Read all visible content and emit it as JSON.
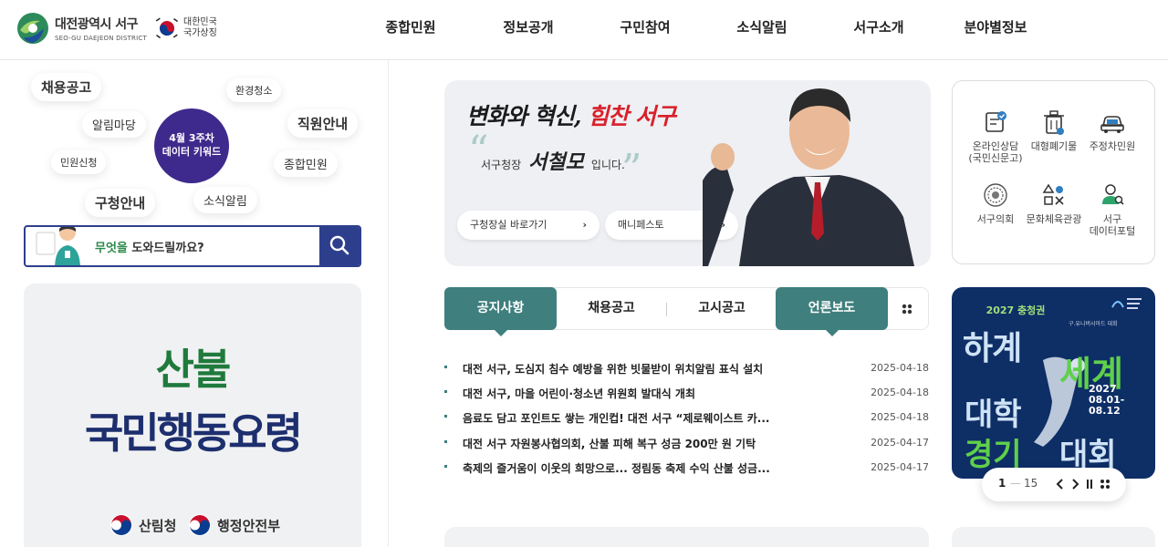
{
  "header": {
    "logo_ko": "대전광역시 서구",
    "logo_en": "SEO-GU DAEJEON DISTRICT",
    "national_symbol_line1": "대한민국",
    "national_symbol_line2": "국가상징",
    "nav": [
      "종합민원",
      "정보공개",
      "구민참여",
      "소식알림",
      "서구소개",
      "분야별정보"
    ]
  },
  "keywords": {
    "center_line1": "4월 3주차",
    "center_line2": "데이터 키워드",
    "items": [
      "채용공고",
      "환경청소",
      "알림마당",
      "직원안내",
      "민원신청",
      "종합민원",
      "구청안내",
      "소식알림"
    ]
  },
  "search": {
    "prompt_highlight": "무엇을",
    "prompt_rest": " 도와드릴까요?"
  },
  "left_banner": {
    "line1": "산불",
    "line2": "국민행동요령",
    "agency1": "산림청",
    "agency2": "행정안전부"
  },
  "mayor_banner": {
    "slogan_part1": "변화와 혁신, ",
    "slogan_part2": "힘찬 서구",
    "title": "서구청장",
    "name": "서철모",
    "ending": "입니다.",
    "btn_office": "구청장실 바로가기",
    "btn_manifesto": "매니페스토"
  },
  "quick_menu": [
    {
      "label": "온라인상담\n(국민신문고)",
      "icon": "consult-icon"
    },
    {
      "label": "대형폐기물",
      "icon": "waste-bin-icon"
    },
    {
      "label": "주정차민원",
      "icon": "car-icon"
    },
    {
      "label": "서구의회",
      "icon": "council-emblem-icon"
    },
    {
      "label": "문화체육관광",
      "icon": "culture-shapes-icon"
    },
    {
      "label": "서구\n데이터포털",
      "icon": "data-portal-icon"
    }
  ],
  "tabs": [
    "공지사항",
    "채용공고",
    "고시공고",
    "언론보도"
  ],
  "news": [
    {
      "title": "대전 서구, 도심지 침수 예방을 위한 빗물받이 위치알림 표식 설치",
      "date": "2025-04-18"
    },
    {
      "title": "대전 서구, 마을 어린이·청소년 위원회 발대식 개최",
      "date": "2025-04-18"
    },
    {
      "title": "음료도 담고 포인트도 쌓는 개인컵! 대전 서구 “제로웨이스트 카...",
      "date": "2025-04-18"
    },
    {
      "title": "대전 서구 자원봉사협의회, 산불 피해 복구 성금 200만 원 기탁",
      "date": "2025-04-17"
    },
    {
      "title": "축제의 즐거움이 이웃의 희망으로... 정림동 축제 수익 산불 성금...",
      "date": "2025-04-17"
    }
  ],
  "poster": {
    "subtitle": "2027 충청권",
    "small": "구.유니버시아드 대회",
    "word1": "하계",
    "word2": "세계",
    "word3": "대학",
    "word4": "경기",
    "word5": "대회",
    "date_line1": "2027",
    "date_line2": "08.01-",
    "date_line3": "08.12"
  },
  "pager": {
    "current": "1",
    "sep": "—",
    "total": "15"
  },
  "colors": {
    "accent_teal": "#3f7f7d",
    "navy": "#2d3f8c",
    "keyword_purple": "#3e2a8c",
    "green": "#1f7a3c"
  }
}
